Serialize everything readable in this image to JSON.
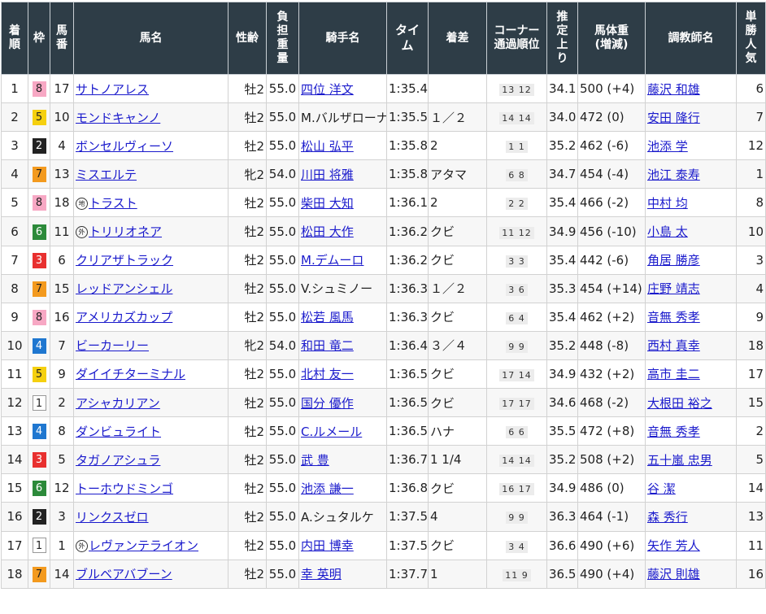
{
  "headers": {
    "rank": "着順",
    "waku": "枠",
    "umaban": "馬番",
    "horse": "馬名",
    "sexage": "性齢",
    "weight": "負担重量",
    "jockey": "騎手名",
    "time": "タイム",
    "margin": "着差",
    "corner_l1": "コーナー",
    "corner_l2": "通過順位",
    "last3f": "推定上り",
    "body_l1": "馬体重",
    "body_l2": "(増減)",
    "trainer": "調教師名",
    "pop": "単勝人気"
  },
  "rows": [
    {
      "rank": "1",
      "waku": "8",
      "umaban": "17",
      "mark": "",
      "horse": "サトノアレス",
      "sexage": "牡2",
      "weight": "55.0",
      "jockey": "四位 洋文",
      "time": "1:35.4",
      "margin": "",
      "corner": "13 12",
      "last3f": "34.1",
      "body": "500 (+4)",
      "trainer": "藤沢 和雄",
      "pop": "6"
    },
    {
      "rank": "2",
      "waku": "5",
      "umaban": "10",
      "mark": "",
      "horse": "モンドキャンノ",
      "sexage": "牡2",
      "weight": "55.0",
      "jockey": "M.バルザローナ",
      "time": "1:35.5",
      "margin": "１／２",
      "corner": "14 14",
      "last3f": "34.0",
      "body": "472 (0)",
      "trainer": "安田 隆行",
      "pop": "7"
    },
    {
      "rank": "3",
      "waku": "2",
      "umaban": "4",
      "mark": "",
      "horse": "ボンセルヴィーソ",
      "sexage": "牡2",
      "weight": "55.0",
      "jockey": "松山 弘平",
      "time": "1:35.8",
      "margin": "2",
      "corner": "1 1",
      "last3f": "35.2",
      "body": "462 (-6)",
      "trainer": "池添 学",
      "pop": "12"
    },
    {
      "rank": "4",
      "waku": "7",
      "umaban": "13",
      "mark": "",
      "horse": "ミスエルテ",
      "sexage": "牝2",
      "weight": "54.0",
      "jockey": "川田 将雅",
      "time": "1:35.8",
      "margin": "アタマ",
      "corner": "6 8",
      "last3f": "34.7",
      "body": "454 (-4)",
      "trainer": "池江 泰寿",
      "pop": "1"
    },
    {
      "rank": "5",
      "waku": "8",
      "umaban": "18",
      "mark": "地",
      "horse": "トラスト",
      "sexage": "牡2",
      "weight": "55.0",
      "jockey": "柴田 大知",
      "time": "1:36.1",
      "margin": "2",
      "corner": "2 2",
      "last3f": "35.4",
      "body": "466 (-2)",
      "trainer": "中村 均",
      "pop": "8"
    },
    {
      "rank": "6",
      "waku": "6",
      "umaban": "11",
      "mark": "外",
      "horse": "トリリオネア",
      "sexage": "牡2",
      "weight": "55.0",
      "jockey": "松田 大作",
      "time": "1:36.2",
      "margin": "クビ",
      "corner": "11 12",
      "last3f": "34.9",
      "body": "456 (-10)",
      "trainer": "小島 太",
      "pop": "10"
    },
    {
      "rank": "7",
      "waku": "3",
      "umaban": "6",
      "mark": "",
      "horse": "クリアザトラック",
      "sexage": "牡2",
      "weight": "55.0",
      "jockey": "M.デムーロ",
      "time": "1:36.2",
      "margin": "クビ",
      "corner": "3 3",
      "last3f": "35.4",
      "body": "442 (-6)",
      "trainer": "角居 勝彦",
      "pop": "3"
    },
    {
      "rank": "8",
      "waku": "7",
      "umaban": "15",
      "mark": "",
      "horse": "レッドアンシェル",
      "sexage": "牡2",
      "weight": "55.0",
      "jockey": "V.シュミノー",
      "time": "1:36.3",
      "margin": "１／２",
      "corner": "3 6",
      "last3f": "35.3",
      "body": "454 (+14)",
      "trainer": "庄野 靖志",
      "pop": "4"
    },
    {
      "rank": "9",
      "waku": "8",
      "umaban": "16",
      "mark": "",
      "horse": "アメリカズカップ",
      "sexage": "牡2",
      "weight": "55.0",
      "jockey": "松若 風馬",
      "time": "1:36.3",
      "margin": "クビ",
      "corner": "6 4",
      "last3f": "35.4",
      "body": "462 (+2)",
      "trainer": "音無 秀孝",
      "pop": "9"
    },
    {
      "rank": "10",
      "waku": "4",
      "umaban": "7",
      "mark": "",
      "horse": "ビーカーリー",
      "sexage": "牝2",
      "weight": "54.0",
      "jockey": "和田 竜二",
      "time": "1:36.4",
      "margin": "３／４",
      "corner": "9 9",
      "last3f": "35.2",
      "body": "448 (-8)",
      "trainer": "西村 真幸",
      "pop": "18"
    },
    {
      "rank": "11",
      "waku": "5",
      "umaban": "9",
      "mark": "",
      "horse": "ダイイチターミナル",
      "sexage": "牡2",
      "weight": "55.0",
      "jockey": "北村 友一",
      "time": "1:36.5",
      "margin": "クビ",
      "corner": "17 14",
      "last3f": "34.9",
      "body": "432 (+2)",
      "trainer": "高市 圭二",
      "pop": "17"
    },
    {
      "rank": "12",
      "waku": "1",
      "umaban": "2",
      "mark": "",
      "horse": "アシャカリアン",
      "sexage": "牡2",
      "weight": "55.0",
      "jockey": "国分 優作",
      "time": "1:36.5",
      "margin": "クビ",
      "corner": "17 17",
      "last3f": "34.6",
      "body": "468 (-2)",
      "trainer": "大根田 裕之",
      "pop": "15"
    },
    {
      "rank": "13",
      "waku": "4",
      "umaban": "8",
      "mark": "",
      "horse": "ダンビュライト",
      "sexage": "牡2",
      "weight": "55.0",
      "jockey": "C.ルメール",
      "time": "1:36.5",
      "margin": "ハナ",
      "corner": "6 6",
      "last3f": "35.5",
      "body": "472 (+8)",
      "trainer": "音無 秀孝",
      "pop": "2"
    },
    {
      "rank": "14",
      "waku": "3",
      "umaban": "5",
      "mark": "",
      "horse": "タガノアシュラ",
      "sexage": "牡2",
      "weight": "55.0",
      "jockey": "武 豊",
      "time": "1:36.7",
      "margin": "1 1/4",
      "corner": "14 14",
      "last3f": "35.2",
      "body": "508 (+2)",
      "trainer": "五十嵐 忠男",
      "pop": "5"
    },
    {
      "rank": "15",
      "waku": "6",
      "umaban": "12",
      "mark": "",
      "horse": "トーホウドミンゴ",
      "sexage": "牡2",
      "weight": "55.0",
      "jockey": "池添 謙一",
      "time": "1:36.8",
      "margin": "クビ",
      "corner": "16 17",
      "last3f": "34.9",
      "body": "486 (0)",
      "trainer": "谷 潔",
      "pop": "14"
    },
    {
      "rank": "16",
      "waku": "2",
      "umaban": "3",
      "mark": "",
      "horse": "リンクスゼロ",
      "sexage": "牡2",
      "weight": "55.0",
      "jockey": "A.シュタルケ",
      "time": "1:37.5",
      "margin": "4",
      "corner": "9 9",
      "last3f": "36.3",
      "body": "464 (-1)",
      "trainer": "森 秀行",
      "pop": "13"
    },
    {
      "rank": "17",
      "waku": "1",
      "umaban": "1",
      "mark": "外",
      "horse": "レヴァンテライオン",
      "sexage": "牡2",
      "weight": "55.0",
      "jockey": "内田 博幸",
      "time": "1:37.5",
      "margin": "クビ",
      "corner": "3 4",
      "last3f": "36.6",
      "body": "490 (+6)",
      "trainer": "矢作 芳人",
      "pop": "11"
    },
    {
      "rank": "18",
      "waku": "7",
      "umaban": "14",
      "mark": "",
      "horse": "ブルベアバブーン",
      "sexage": "牡2",
      "weight": "55.0",
      "jockey": "幸 英明",
      "time": "1:37.7",
      "margin": "1",
      "corner": "11 9",
      "last3f": "36.5",
      "body": "490 (+4)",
      "trainer": "藤沢 則雄",
      "pop": "16"
    }
  ],
  "link_jockeys": [
    true,
    false,
    true,
    true,
    true,
    true,
    true,
    false,
    true,
    true,
    true,
    true,
    true,
    true,
    true,
    false,
    true,
    true
  ]
}
